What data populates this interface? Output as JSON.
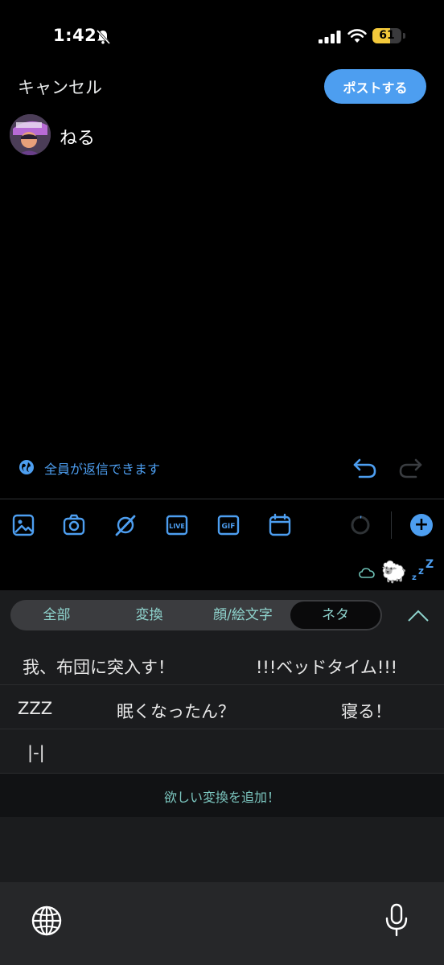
{
  "status_bar": {
    "time": "1:42",
    "battery_level": "61"
  },
  "header": {
    "cancel_label": "キャンセル",
    "post_label": "ポストする"
  },
  "compose": {
    "text": "ねる"
  },
  "reply_setting": {
    "label": "全員が返信できます"
  },
  "toolbar": {
    "icons": [
      "image-icon",
      "camera-icon",
      "grok-icon",
      "live-icon",
      "gif-icon",
      "schedule-icon"
    ],
    "accent_color": "#4d9ef0"
  },
  "suggestion": {
    "text": "☁🐑"
  },
  "keyboard": {
    "tabs": [
      "全部",
      "変換",
      "顔/絵文字",
      "ネタ"
    ],
    "active_tab": "ネタ",
    "candidates_row1": [
      "我、布団に突入す！",
      "!!!ベッドタイム!!!"
    ],
    "candidates_row2": [
      "ZZZ",
      "眠くなったん？",
      "寝る！"
    ],
    "candidates_row3": [
      "|-|"
    ],
    "add_conversion": "欲しい変換を追加！"
  }
}
